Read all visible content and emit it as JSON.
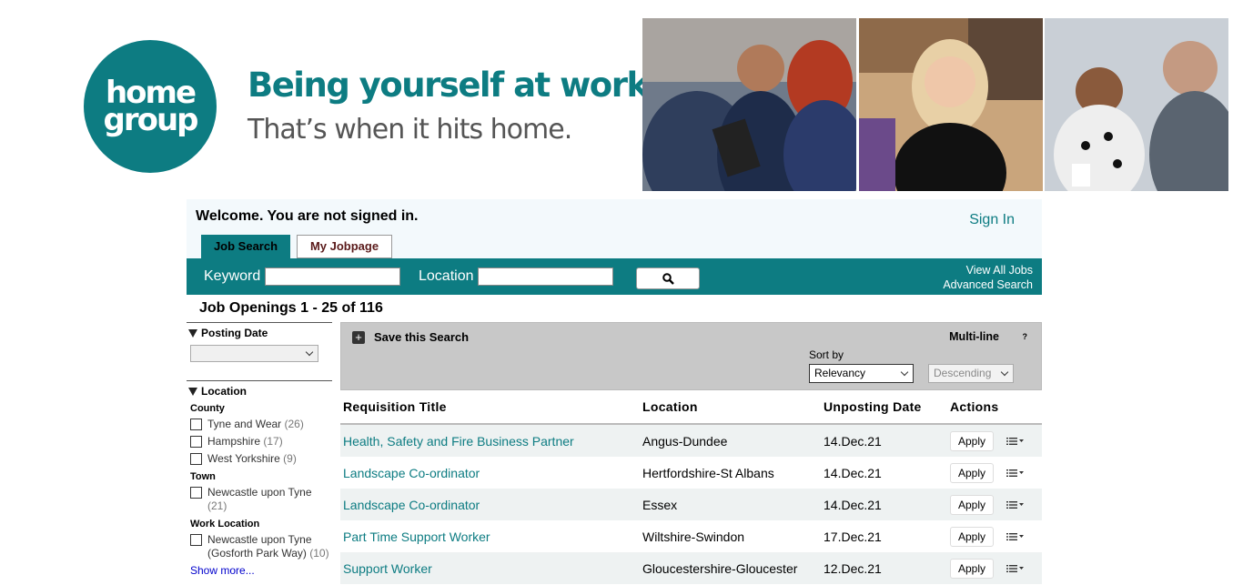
{
  "banner": {
    "logo_text": "home\ngroup",
    "tagline_main": "Being yourself at work.",
    "tagline_sub": "That’s when it hits home.",
    "brand_color": "#0d7c82"
  },
  "header": {
    "welcome": "Welcome. You are not signed in.",
    "sign_in": "Sign In",
    "tabs": [
      {
        "label": "Job Search",
        "active": true
      },
      {
        "label": "My Jobpage",
        "active": false
      }
    ]
  },
  "search": {
    "keyword_label": "Keyword",
    "keyword_value": "",
    "location_label": "Location",
    "location_value": "",
    "search_icon": "search-icon",
    "view_all": "View All Jobs",
    "advanced": "Advanced Search"
  },
  "openings": "Job Openings 1 - 25 of 116",
  "sidebar": {
    "posting_date": {
      "heading": "Posting Date",
      "value": ""
    },
    "location": {
      "heading": "Location",
      "county": {
        "label": "County",
        "items": [
          {
            "name": "Tyne and Wear",
            "count": "(26)"
          },
          {
            "name": "Hampshire",
            "count": "(17)"
          },
          {
            "name": "West Yorkshire",
            "count": "(9)"
          }
        ]
      },
      "town": {
        "label": "Town",
        "items": [
          {
            "name": "Newcastle upon Tyne",
            "count": "(21)"
          }
        ]
      },
      "work_location": {
        "label": "Work Location",
        "items": [
          {
            "name": "Newcastle upon Tyne (Gosforth Park Way)",
            "count": "(10)"
          }
        ]
      },
      "show_more": "Show more..."
    }
  },
  "toolbar": {
    "save_search": "Save this Search",
    "plus_icon": "+",
    "multi_line": "Multi-line",
    "help": "?",
    "sort_by_label": "Sort by",
    "sort_by_value": "Relevancy",
    "order_value": "Descending"
  },
  "table": {
    "headers": [
      "Requisition Title",
      "Location",
      "Unposting Date",
      "Actions"
    ],
    "apply_label": "Apply",
    "rows": [
      {
        "title": "Health, Safety and Fire Business Partner",
        "location": "Angus-Dundee",
        "date": "14.Dec.21"
      },
      {
        "title": "Landscape Co-ordinator",
        "location": "Hertfordshire-St Albans",
        "date": "14.Dec.21"
      },
      {
        "title": "Landscape Co-ordinator",
        "location": "Essex",
        "date": "14.Dec.21"
      },
      {
        "title": "Part Time Support Worker",
        "location": "Wiltshire-Swindon",
        "date": "17.Dec.21"
      },
      {
        "title": "Support Worker",
        "location": "Gloucestershire-Gloucester",
        "date": "12.Dec.21"
      }
    ]
  }
}
